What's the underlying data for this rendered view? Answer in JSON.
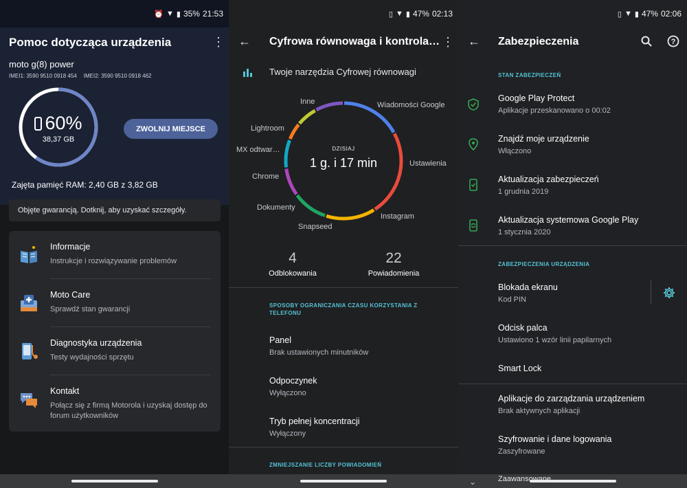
{
  "panel1": {
    "status": {
      "battery": "35%",
      "time": "21:53"
    },
    "title": "Pomoc dotycząca urządzenia",
    "model": "moto g(8) power",
    "imei1": "IMEI1: 3590 9510 0918 454",
    "imei2": "IMEI2: 3590 9510 0918 462",
    "storage": {
      "percent": "60%",
      "used": "38,37 GB",
      "fill": 0.6
    },
    "free_button": "ZWOLNIJ MIEJSCE",
    "ram": "Zajęta pamięć RAM: 2,40 GB z 3,82 GB",
    "warranty": "Objęte gwarancją. Dotknij, aby uzyskać szczegóły.",
    "items": [
      {
        "title": "Informacje",
        "subtitle": "Instrukcje i rozwiązywanie problemów",
        "icon": "book-icon"
      },
      {
        "title": "Moto Care",
        "subtitle": "Sprawdź stan gwarancji",
        "icon": "medical-kit-icon"
      },
      {
        "title": "Diagnostyka urządzenia",
        "subtitle": "Testy wydajności sprzętu",
        "icon": "stethoscope-icon"
      },
      {
        "title": "Kontakt",
        "subtitle": "Połącz się z firmą Motorola i uzyskaj dostęp do forum użytkowników",
        "icon": "chat-bubbles-icon"
      }
    ]
  },
  "panel2": {
    "status": {
      "battery": "47%",
      "time": "02:13"
    },
    "title": "Cyfrowa równowaga i kontrola…",
    "tools": "Twoje narzędzia Cyfrowej równowagi",
    "today_label": "DZISIAJ",
    "today_value": "1 g. i 17 min",
    "donut_labels": [
      "Inne",
      "Wiadomości Google",
      "Lightroom",
      "MX odtwar…",
      "Ustawienia",
      "Chrome",
      "Dokumenty",
      "Instagram",
      "Snapseed"
    ],
    "donut_segments": [
      {
        "color": "#4f81e8",
        "frac": 0.17
      },
      {
        "color": "#e94b3c",
        "frac": 0.24
      },
      {
        "color": "#f2b400",
        "frac": 0.14
      },
      {
        "color": "#1fa463",
        "frac": 0.1
      },
      {
        "color": "#ab47bc",
        "frac": 0.08
      },
      {
        "color": "#12a7c6",
        "frac": 0.08
      },
      {
        "color": "#f47c20",
        "frac": 0.05
      },
      {
        "color": "#c0ca33",
        "frac": 0.06
      },
      {
        "color": "#7e57c2",
        "frac": 0.08
      }
    ],
    "unlocks": {
      "value": "4",
      "label": "Odblokowania"
    },
    "notifications": {
      "value": "22",
      "label": "Powiadomienia"
    },
    "section1": "SPOSOBY OGRANICZANIA CZASU KORZYSTANIA Z TELEFONU",
    "items": [
      {
        "title": "Panel",
        "subtitle": "Brak ustawionych minutników"
      },
      {
        "title": "Odpoczynek",
        "subtitle": "Wyłączono"
      },
      {
        "title": "Tryb pełnej koncentracji",
        "subtitle": "Wyłączony"
      }
    ],
    "section2": "ZMNIEJSZANIE LICZBY POWIADOMIEŃ"
  },
  "panel3": {
    "status": {
      "battery": "47%",
      "time": "02:06"
    },
    "title": "Zabezpieczenia",
    "section1": "STAN ZABEZPIECZEŃ",
    "status_items": [
      {
        "title": "Google Play Protect",
        "subtitle": "Aplikacje przeskanowano o 00:02",
        "icon": "shield-check-icon"
      },
      {
        "title": "Znajdź moje urządzenie",
        "subtitle": "Włączono",
        "icon": "location-pin-icon"
      },
      {
        "title": "Aktualizacja zabezpieczeń",
        "subtitle": "1 grudnia 2019",
        "icon": "phone-check-icon"
      },
      {
        "title": "Aktualizacja systemowa Google Play",
        "subtitle": "1 stycznia 2020",
        "icon": "phone-sync-icon"
      }
    ],
    "section2": "ZABEZPIECZENIA URZĄDZENIA",
    "device_items": [
      {
        "title": "Blokada ekranu",
        "subtitle": "Kod PIN"
      },
      {
        "title": "Odcisk palca",
        "subtitle": "Ustawiono 1 wzór linii papilarnych"
      },
      {
        "title": "Smart Lock",
        "subtitle": ""
      }
    ],
    "other_items": [
      {
        "title": "Aplikacje do zarządzania urządzeniem",
        "subtitle": "Brak aktywnych aplikacji"
      },
      {
        "title": "Szyfrowanie i dane logowania",
        "subtitle": "Zaszyfrowane"
      }
    ],
    "advanced": "Zaawansowane"
  }
}
